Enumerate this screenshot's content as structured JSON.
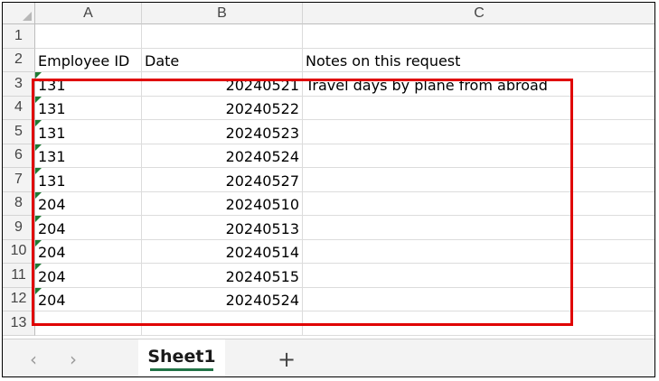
{
  "spreadsheet": {
    "columns": [
      "A",
      "B",
      "C"
    ],
    "row_numbers": [
      "1",
      "2",
      "3",
      "4",
      "5",
      "6",
      "7",
      "8",
      "9",
      "10",
      "11",
      "12",
      "13"
    ],
    "header_row": {
      "a": "Employee ID",
      "b": "Date",
      "c": "Notes on this request"
    },
    "rows": [
      {
        "a": "131",
        "b": "20240521",
        "c": "Travel days by plane from abroad"
      },
      {
        "a": "131",
        "b": "20240522",
        "c": ""
      },
      {
        "a": "131",
        "b": "20240523",
        "c": ""
      },
      {
        "a": "131",
        "b": "20240524",
        "c": ""
      },
      {
        "a": "131",
        "b": "20240527",
        "c": ""
      },
      {
        "a": "204",
        "b": "20240510",
        "c": ""
      },
      {
        "a": "204",
        "b": "20240513",
        "c": ""
      },
      {
        "a": "204",
        "b": "20240514",
        "c": ""
      },
      {
        "a": "204",
        "b": "20240515",
        "c": ""
      },
      {
        "a": "204",
        "b": "20240524",
        "c": ""
      }
    ],
    "highlight_color": "#e00000",
    "error_indicator_color": "#1e7b34"
  },
  "tabbar": {
    "prev_icon": "chevron-left-icon",
    "next_icon": "chevron-right-icon",
    "sheet_tab": "Sheet1",
    "add_icon": "plus-icon"
  }
}
